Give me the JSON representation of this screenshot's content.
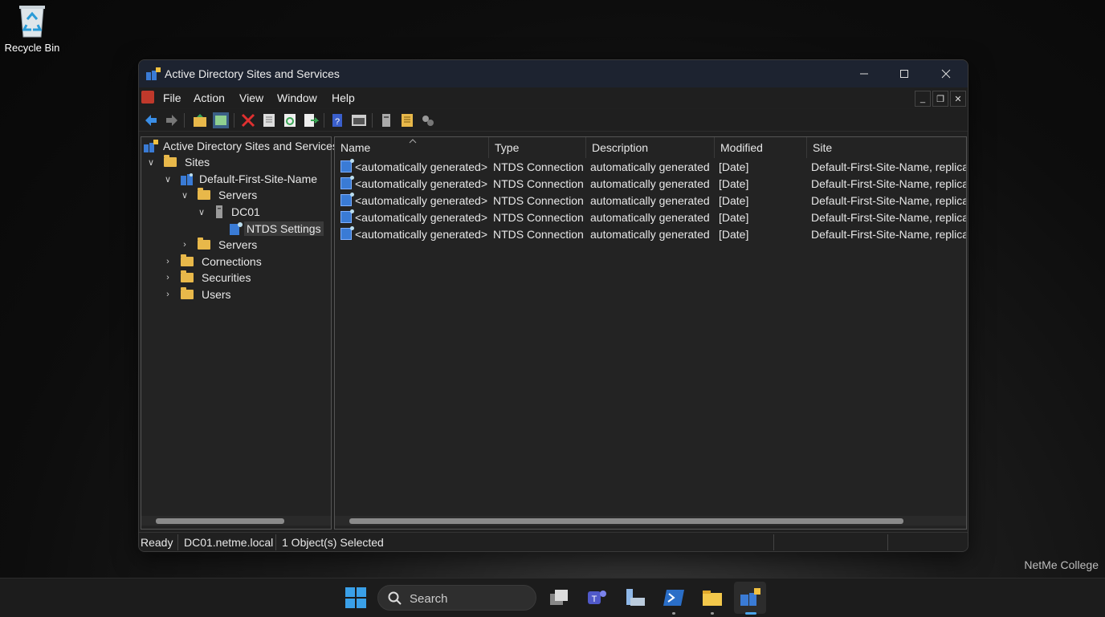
{
  "desktop": {
    "recycle_bin_label": "Recycle Bin",
    "watermark": "NetMe College"
  },
  "window": {
    "title": "Active Directory Sites and Services",
    "menu": [
      "File",
      "Action",
      "View",
      "Window",
      "Help"
    ]
  },
  "tree": {
    "root": "Active Directory Sites and Services",
    "sites": "Sites",
    "site": "Default-First-Site-Name",
    "servers": "Servers",
    "dc": "DC01",
    "ntds": "NTDS Settings",
    "servers2": "Servers",
    "connections": "Cornections",
    "securities": "Securities",
    "users": "Users"
  },
  "list": {
    "columns": [
      "Name",
      "Type",
      "Description",
      "Modified",
      "Site"
    ],
    "rows": [
      [
        "<automatically generated>",
        "NTDS Connection",
        "automatically generated",
        "[Date]",
        "Default-First-Site-Name, replicat"
      ],
      [
        "<automatically generated>",
        "NTDS Connection",
        "automatically generated",
        "[Date]",
        "Default-First-Site-Name, replicat"
      ],
      [
        "<automatically generated>",
        "NTDS Connection",
        "automatically generated",
        "[Date]",
        "Default-First-Site-Name, replicat"
      ],
      [
        "<automatically generated>",
        "NTDS Connection",
        "automatically generated",
        "[Date]",
        "Default-First-Site-Name, replicat"
      ],
      [
        "<automatically generated>",
        "NTDS Connection",
        "automatically generated",
        "[Date]",
        "Default-First-Site-Name, replicat"
      ]
    ]
  },
  "status": {
    "state": "Ready",
    "server": "DC01.netme.local",
    "selection": "1 Object(s) Selected"
  },
  "taskbar": {
    "search_label": "Search"
  },
  "icons": {
    "toolbar": [
      "back-arrow-icon",
      "forward-arrow-icon",
      "up-folder-icon",
      "show-hide-tree-icon",
      "delete-icon",
      "properties-icon",
      "refresh-icon",
      "export-list-icon",
      "help-icon",
      "console-icon",
      "server-icon",
      "list-icon",
      "replicate-icon"
    ],
    "taskbar": [
      "windows-start-icon",
      "search-icon",
      "task-view-icon",
      "teams-icon",
      "server-manager-icon",
      "powershell-icon",
      "file-explorer-icon",
      "sites-services-icon"
    ]
  }
}
